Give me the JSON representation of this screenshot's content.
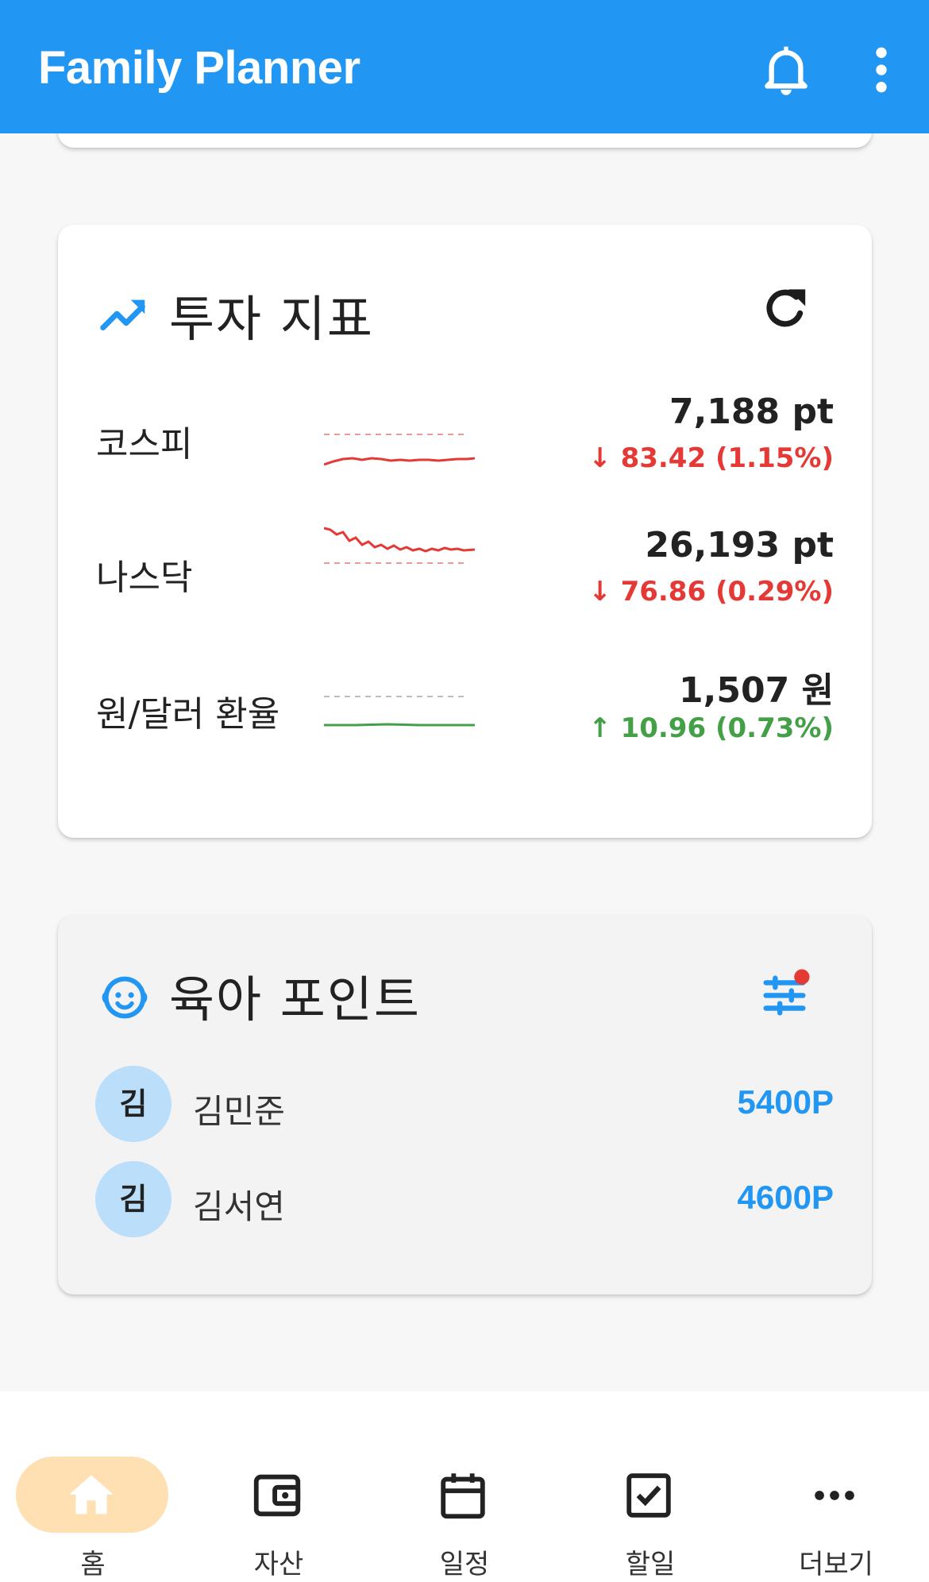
{
  "app": {
    "title": "Family Planner"
  },
  "invest": {
    "title": "투자 지표",
    "indices": [
      {
        "name": "코스피",
        "value": "7,188 pt",
        "change": "83.42 (1.15%)",
        "direction": "down"
      },
      {
        "name": "나스닥",
        "value": "26,193 pt",
        "change": "76.86 (0.29%)",
        "direction": "down"
      },
      {
        "name": "원/달러 환율",
        "value": "1,507 원",
        "change": "10.96 (0.73%)",
        "direction": "up"
      }
    ]
  },
  "kids": {
    "title": "육아 포인트",
    "children": [
      {
        "initial": "김",
        "name": "김민준",
        "points": "5400P"
      },
      {
        "initial": "김",
        "name": "김서연",
        "points": "4600P"
      }
    ]
  },
  "nav": {
    "items": [
      {
        "label": "홈",
        "icon": "home-icon",
        "active": true
      },
      {
        "label": "자산",
        "icon": "wallet-icon",
        "active": false
      },
      {
        "label": "일정",
        "icon": "calendar-icon",
        "active": false
      },
      {
        "label": "할일",
        "icon": "checkbox-icon",
        "active": false
      },
      {
        "label": "더보기",
        "icon": "more-horiz-icon",
        "active": false
      }
    ]
  },
  "colors": {
    "primary": "#2196f3",
    "down": "#e53935",
    "up": "#43a047",
    "nav_active": "#ffe0b2",
    "avatar": "#bbdefb"
  }
}
